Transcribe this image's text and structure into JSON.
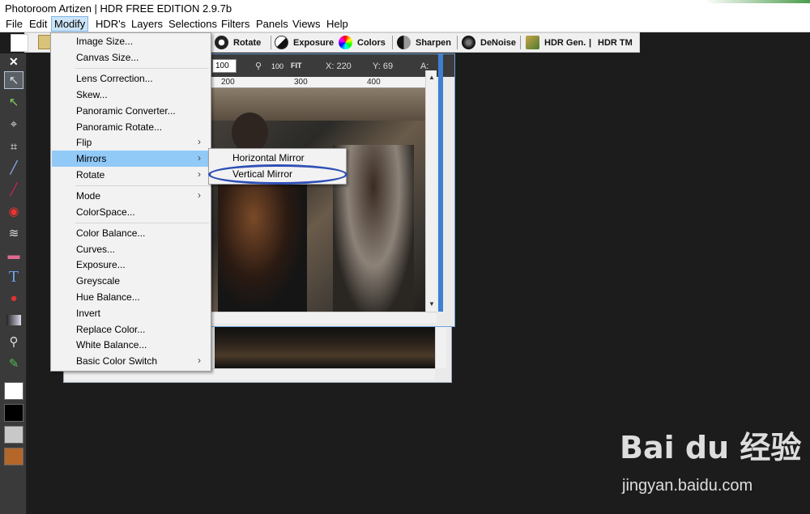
{
  "window": {
    "title": "Photoroom Artizen | HDR FREE EDITION 2.9.7b"
  },
  "menubar": [
    "File",
    "Edit",
    "Modify",
    "HDR's",
    "Layers",
    "Selections",
    "Filters",
    "Panels",
    "Views",
    "Help"
  ],
  "toolbar": {
    "rotate": "Rotate",
    "exposure": "Exposure",
    "colors": "Colors",
    "sharpen": "Sharpen",
    "denoise": "DeNoise",
    "hdr_gen": "HDR Gen.",
    "divider": "|",
    "hdr_tm": "HDR TM"
  },
  "doc": {
    "zoom": "100",
    "zoom100": "100",
    "fit": "FIT",
    "x": "X: 220",
    "y": "Y: 69",
    "a": "A:",
    "ruler": [
      "200",
      "300",
      "400"
    ]
  },
  "modify_menu": {
    "items": [
      "Image Size...",
      "Canvas Size...",
      "Lens Correction...",
      "Skew...",
      "Panoramic Converter...",
      "Panoramic Rotate...",
      "Flip",
      "Mirrors",
      "Rotate",
      "Mode",
      "ColorSpace...",
      "Color Balance...",
      "Curves...",
      "Exposure...",
      "Greyscale",
      "Hue Balance...",
      "Invert",
      "Replace Color...",
      "White Balance...",
      "Basic Color Switch"
    ],
    "highlighted": "Mirrors"
  },
  "mirrors_submenu": [
    "Horizontal Mirror",
    "Vertical Mirror"
  ],
  "watermark": {
    "logo": "Bai du 经验",
    "url": "jingyan.baidu.com"
  },
  "colors": {
    "menu_highlight": "#91c9f7",
    "annotation_oval": "#2f4fb5",
    "app_bg": "#1c1c1c"
  },
  "icons": [
    "new-file-icon",
    "open-folder-icon",
    "rotate-icon",
    "exposure-icon",
    "colors-wheel-icon",
    "sharpen-icon",
    "denoise-icon",
    "hdr-gen-icon",
    "arrow-select-icon",
    "add-arrow-icon",
    "lasso-icon",
    "crop-icon",
    "brush-icon",
    "pen-icon",
    "red-eye-icon",
    "wave-icon",
    "eraser-icon",
    "text-icon",
    "bucket-icon",
    "gradient-icon",
    "magnifier-icon",
    "eyedropper-icon"
  ]
}
